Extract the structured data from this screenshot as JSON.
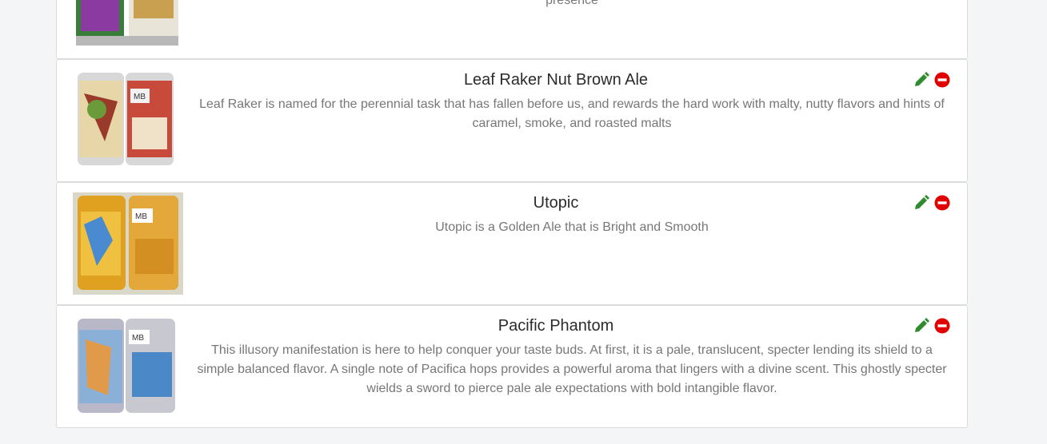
{
  "colors": {
    "edit": "#2e8b2e",
    "delete": "#e00000",
    "title": "#2b2b2b",
    "description": "#777777"
  },
  "icons": {
    "edit": "pencil-icon",
    "delete": "minus-circle-icon"
  },
  "beers": [
    {
      "name": "",
      "description": "color and smell its rich malt base. The flavor follows the aroma, and is toasty with a touch of sweetness and a slight noble hop presence"
    },
    {
      "name": "Leaf Raker Nut Brown Ale",
      "description": "Leaf Raker is named for the perennial task that has fallen before us, and rewards the hard work with malty, nutty flavors and hints of caramel, smoke, and roasted malts"
    },
    {
      "name": "Utopic",
      "description": "Utopic is a Golden Ale that is Bright and Smooth"
    },
    {
      "name": "Pacific Phantom",
      "description": "This illusory manifestation is here to help conquer your taste buds. At first, it is a pale, translucent, specter lending its shield to a simple balanced flavor. A single note of Pacifica hops provides a powerful aroma that lingers with a divine scent. This ghostly specter wields a sword to pierce pale ale expectations with bold intangible flavor."
    }
  ]
}
